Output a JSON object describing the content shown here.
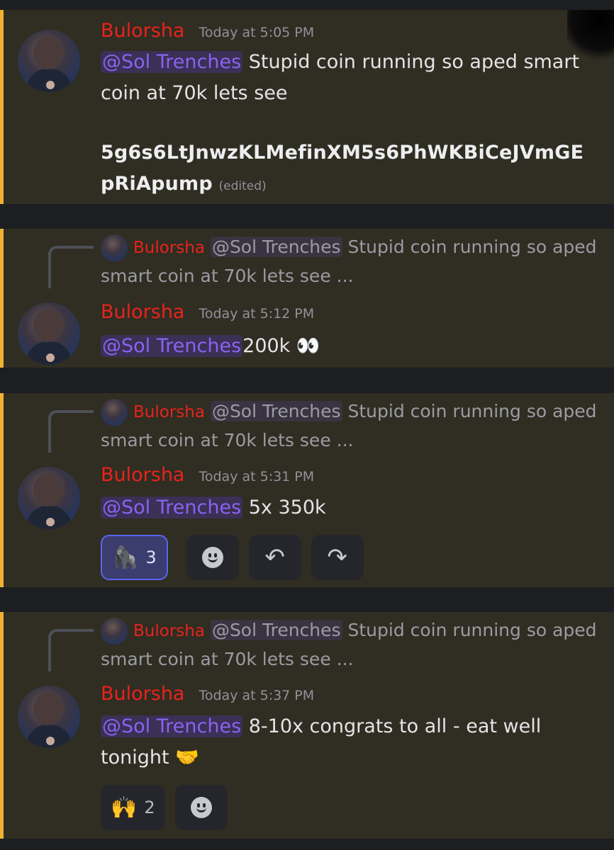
{
  "messages": [
    {
      "username": "Bulorsha",
      "timestamp": "Today at 5:05 PM",
      "mention": "@Sol Trenches",
      "text": " Stupid coin running so aped smart coin at 70k lets see",
      "code": "5g6s6LtJnwzKLMefinXM5s6PhWKBiCeJVmGEpRiApump",
      "edited": "(edited)"
    },
    {
      "reply": {
        "username": "Bulorsha",
        "mention": "@Sol Trenches",
        "text": " Stupid coin running so aped smart coin at 70k lets see  ..."
      },
      "username": "Bulorsha",
      "timestamp": "Today at 5:12 PM",
      "mention": "@Sol Trenches",
      "text": "200k 👀"
    },
    {
      "reply": {
        "username": "Bulorsha",
        "mention": "@Sol Trenches",
        "text": " Stupid coin running so aped smart coin at 70k lets see  ..."
      },
      "username": "Bulorsha",
      "timestamp": "Today at 5:31 PM",
      "mention": "@Sol Trenches",
      "text": " 5x 350k",
      "reactions": [
        {
          "emoji": "🦍",
          "count": "3"
        }
      ]
    },
    {
      "reply": {
        "username": "Bulorsha",
        "mention": "@Sol Trenches",
        "text": " Stupid coin running so aped smart coin at 70k lets see  ..."
      },
      "username": "Bulorsha",
      "timestamp": "Today at 5:37 PM",
      "mention": "@Sol Trenches",
      "text": " 8-10x congrats to all - eat well tonight 🤝",
      "reactions": [
        {
          "emoji": "🙌",
          "count": "2"
        }
      ]
    }
  ],
  "icons": {
    "reply_arrow": "↶",
    "forward_arrow": "↷",
    "add_reaction": "smiley-icon"
  },
  "colors": {
    "username": "#e8231d",
    "mention": "#8a63f0",
    "highlight_bar": "#f0b232"
  }
}
